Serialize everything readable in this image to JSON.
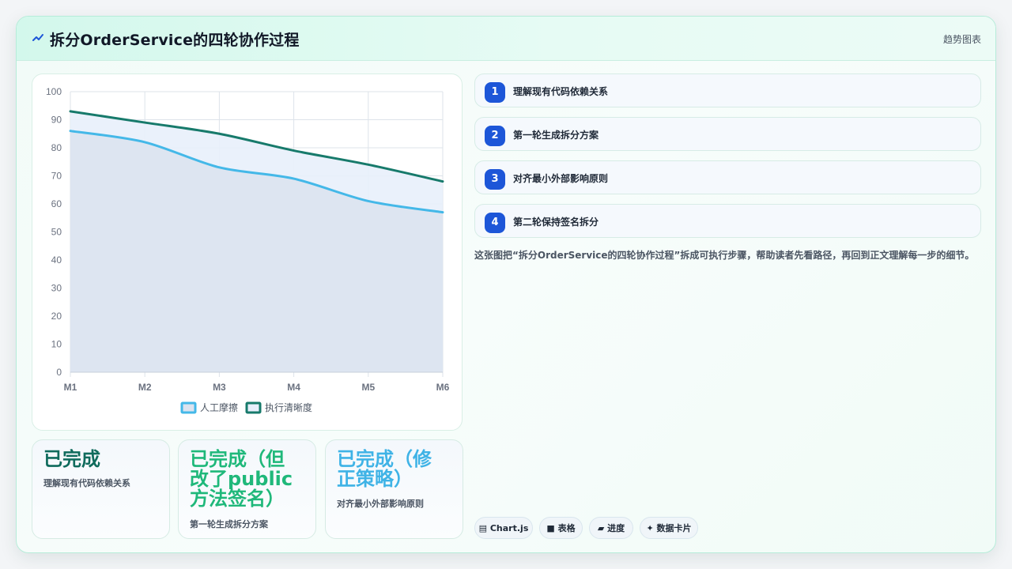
{
  "header": {
    "logo_icon": "zigzag-icon",
    "title": "拆分OrderService的四轮协作过程",
    "tag": "趋势图表"
  },
  "chart_data": {
    "type": "area",
    "categories": [
      "M1",
      "M2",
      "M3",
      "M4",
      "M5",
      "M6"
    ],
    "series": [
      {
        "name": "人工摩擦",
        "values": [
          86,
          82,
          73,
          69,
          61,
          57
        ],
        "color": "#44b8e8",
        "fill": "#dce3ef"
      },
      {
        "name": "执行清晰度",
        "values": [
          93,
          89,
          85,
          79,
          74,
          68
        ],
        "color": "#177a6b",
        "fill": "#e8effb"
      }
    ],
    "ylim": [
      0,
      100
    ],
    "yticks": [
      0,
      10,
      20,
      30,
      40,
      50,
      60,
      70,
      80,
      90,
      100
    ],
    "grid": true,
    "legend": "bottom"
  },
  "steps": [
    {
      "num": "1",
      "label": "理解现有代码依赖关系"
    },
    {
      "num": "2",
      "label": "第一轮生成拆分方案"
    },
    {
      "num": "3",
      "label": "对齐最小外部影响原则"
    },
    {
      "num": "4",
      "label": "第二轮保持签名拆分"
    }
  ],
  "description": "这张图把“拆分OrderService的四轮协作过程”拆成可执行步骤，帮助读者先看路径，再回到正文理解每一步的细节。",
  "stats": [
    {
      "value_lines": [
        "已完成"
      ],
      "caption": "理解现有代码依赖关系",
      "color": "#0f6b5c"
    },
    {
      "value_lines": [
        "已完成（但",
        "改了public",
        "方法签名）"
      ],
      "caption": "第一轮生成拆分方案",
      "color": "#1fb87a"
    },
    {
      "value_lines": [
        "已完成（修",
        "正策略）"
      ],
      "caption": "对齐最小外部影响原则",
      "color": "#3fb3e6"
    }
  ],
  "pills": [
    {
      "icon": "chart-icon",
      "glyph": "▤",
      "label": "Chart.js"
    },
    {
      "icon": "table-icon",
      "glyph": "■",
      "label": "表格"
    },
    {
      "icon": "progress-icon",
      "glyph": "▰",
      "label": "进度"
    },
    {
      "icon": "sparkle-icon",
      "glyph": "✦",
      "label": "数据卡片"
    }
  ]
}
